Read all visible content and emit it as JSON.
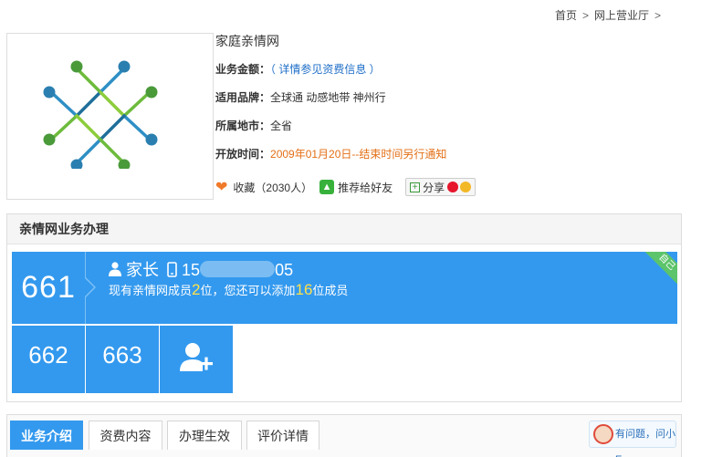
{
  "breadcrumb": {
    "home": "首页",
    "sep": ">",
    "hall": "网上营业厅",
    "sep2": ">"
  },
  "product": {
    "title": "家庭亲情网",
    "fee_label": "业务金额：",
    "fee_value": "（ 详情参见资费信息 ）",
    "brand_label": "适用品牌：",
    "brand_value": "全球通 动感地带 神州行",
    "region_label": "所属地市：",
    "region_value": "全省",
    "time_label": "开放时间：",
    "time_value": "2009年01月20日--结束时间另行通知",
    "favorite_label": "收藏（2030人）",
    "recommend_label": "推荐给好友",
    "share_label": "分享"
  },
  "panel": {
    "title": "亲情网业务办理",
    "card": {
      "short_number": "661",
      "role": "家长",
      "phone_prefix": "15",
      "phone_suffix": "05",
      "desc_a": "现有亲情网成员",
      "members_count": "2",
      "desc_b": "位，您还可以添加",
      "remaining": "16",
      "desc_c": "位成员",
      "ribbon": "自己"
    },
    "members": [
      "662",
      "663"
    ]
  },
  "tabs": [
    "业务介绍",
    "资费内容",
    "办理生效",
    "评价详情"
  ],
  "help_label": "有问题，问小E",
  "colors": {
    "accent": "#3399ee",
    "orange": "#e36f16",
    "link": "#1e6ec8",
    "highlight": "#ffe24a"
  }
}
